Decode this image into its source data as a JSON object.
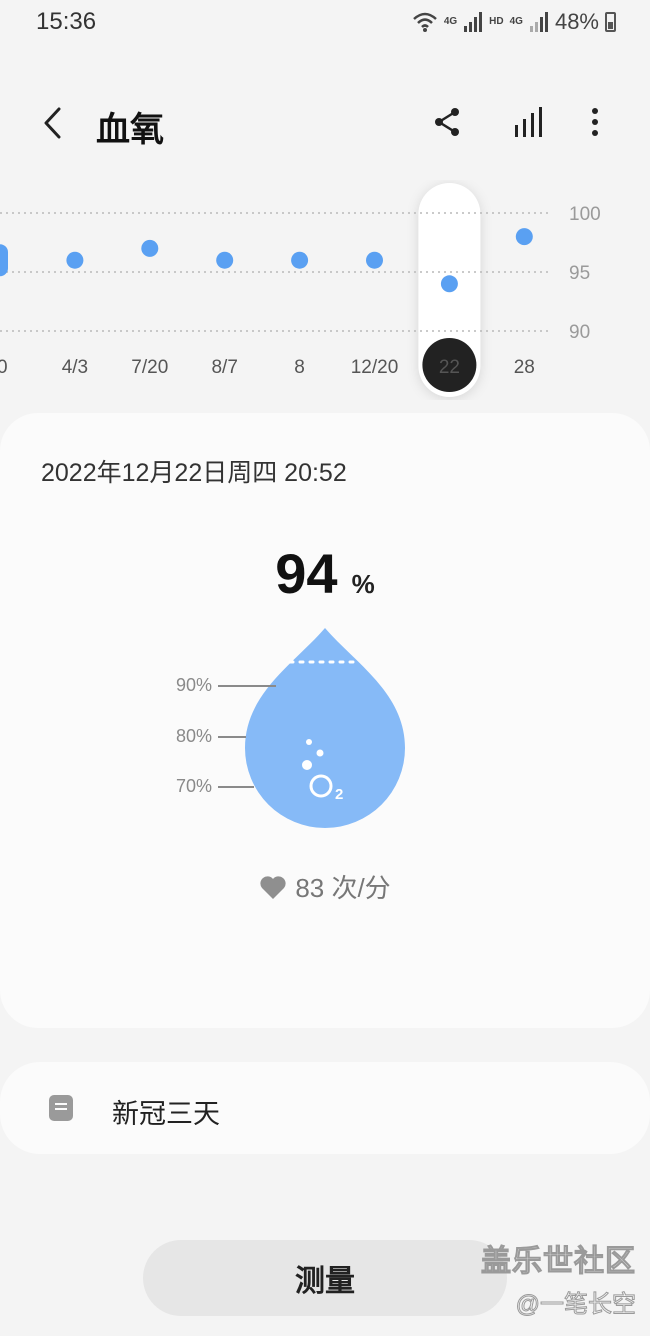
{
  "status_bar": {
    "time": "15:36",
    "wifi_label": "4G",
    "hd_label": "HD",
    "sim2_label": "4G",
    "battery": "48%"
  },
  "header": {
    "title": "血氧",
    "icons": [
      "back-arrow-icon",
      "share-icon",
      "chart-bars-icon",
      "more-vertical-icon"
    ]
  },
  "chart_data": {
    "type": "scatter",
    "x_labels": [
      "0",
      "4/3",
      "7/20",
      "8/7",
      "8",
      "12/20",
      "22",
      "28"
    ],
    "values": [
      null,
      96,
      97,
      96,
      96,
      96,
      94,
      98
    ],
    "partial_left_value": 96,
    "y_ticks": [
      "100",
      "95",
      "90"
    ],
    "ylim": [
      90,
      100
    ],
    "selected_label": "22",
    "point_color": "#5aa0f2",
    "grid": true
  },
  "reading": {
    "datetime": "2022年12月22日周四 20:52",
    "value": "94",
    "unit": "%",
    "drop_ticks": [
      "90%",
      "80%",
      "70%"
    ],
    "heart_rate": "83 次/分",
    "drop_color": "#86baf7"
  },
  "note": {
    "text": "新冠三天"
  },
  "actions": {
    "measure_label": "测量"
  },
  "watermark": {
    "line1": "盖乐世社区",
    "line2": "@一笔长空"
  }
}
